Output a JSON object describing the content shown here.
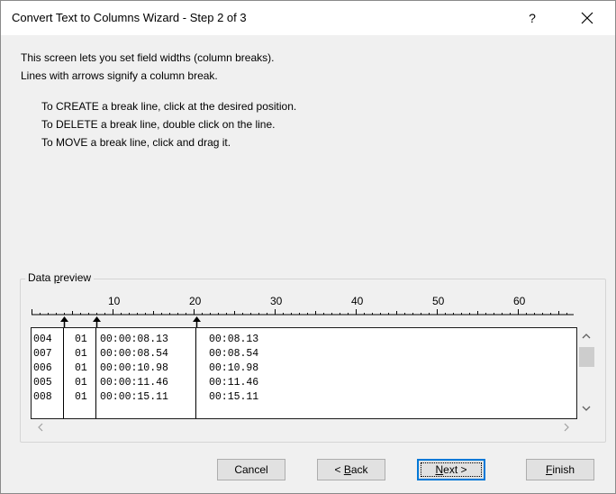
{
  "window": {
    "title": "Convert Text to Columns Wizard - Step 2 of 3",
    "help_label": "?"
  },
  "instructions": {
    "line1": "This screen lets you set field widths (column breaks).",
    "line2": "Lines with arrows signify a column break.",
    "create": "To CREATE a break line, click at the desired position.",
    "delete": "To DELETE a break line, double click on the line.",
    "move": "To MOVE a break line, click and drag it."
  },
  "data_preview": {
    "label_pre": "Data ",
    "label_accel": "p",
    "label_post": "review",
    "ruler_ticks": [
      "10",
      "20",
      "30",
      "40",
      "50",
      "60"
    ],
    "rows": [
      {
        "c1": "004",
        "c2": "01",
        "c3": "00:00:08.13",
        "c4": "00:08.13"
      },
      {
        "c1": "007",
        "c2": "01",
        "c3": "00:00:08.54",
        "c4": "00:08.54"
      },
      {
        "c1": "006",
        "c2": "01",
        "c3": "00:00:10.98",
        "c4": "00:10.98"
      },
      {
        "c1": "005",
        "c2": "01",
        "c3": "00:00:11.46",
        "c4": "00:11.46"
      },
      {
        "c1": "008",
        "c2": "01",
        "c3": "00:00:15.11",
        "c4": "00:15.11"
      }
    ]
  },
  "buttons": {
    "cancel": "Cancel",
    "back_pre": "< ",
    "back_accel": "B",
    "back_post": "ack",
    "next_accel": "N",
    "next_post": "ext >",
    "finish_accel": "F",
    "finish_post": "inish"
  }
}
